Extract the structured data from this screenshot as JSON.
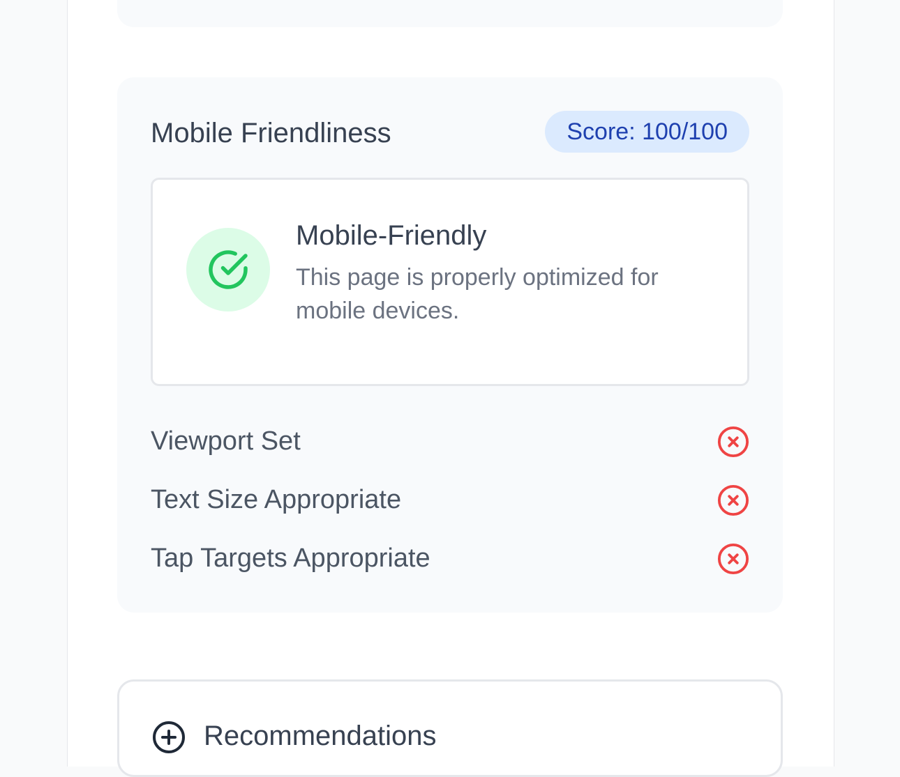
{
  "mobile_section": {
    "title": "Mobile Friendliness",
    "score": "Score: 100/100",
    "status": {
      "icon": "check-circle-icon",
      "heading": "Mobile-Friendly",
      "description": "This page is properly optimized for mobile devices."
    },
    "checks": [
      {
        "label": "Viewport Set",
        "status": "fail",
        "icon": "x-circle-icon"
      },
      {
        "label": "Text Size Appropriate",
        "status": "fail",
        "icon": "x-circle-icon"
      },
      {
        "label": "Tap Targets Appropriate",
        "status": "fail",
        "icon": "x-circle-icon"
      }
    ]
  },
  "recommendations": {
    "icon": "plus-circle-icon",
    "title": "Recommendations"
  },
  "colors": {
    "badge_bg": "#dbeafe",
    "badge_text": "#1e40af",
    "success": "#22c55e",
    "success_bg": "#dcfce7",
    "fail": "#ef4444"
  }
}
